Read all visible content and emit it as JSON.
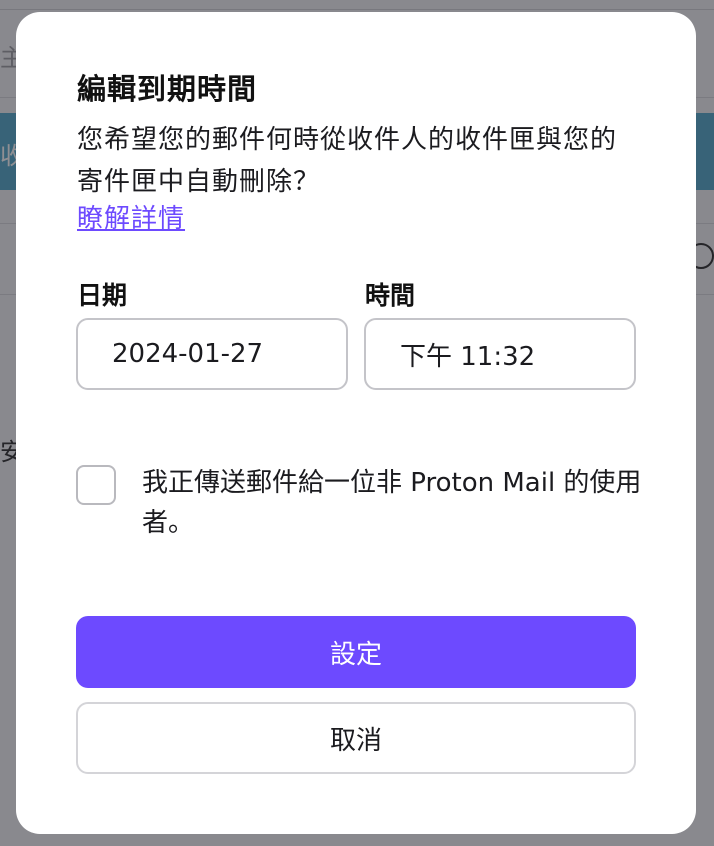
{
  "background": {
    "text_1": "主旨",
    "text_2": "收",
    "text_3": "安"
  },
  "modal": {
    "title": "編輯到期時間",
    "description": "您希望您的郵件何時從收件人的收件匣與您的寄件匣中自動刪除？",
    "learn_more": "瞭解詳情",
    "date_label": "日期",
    "date_value": "2024-01-27",
    "time_label": "時間",
    "time_value": "下午 11:32",
    "checkbox_label": "我正傳送郵件給一位非 Proton Mail 的使用者。",
    "checkbox_checked": false,
    "set_button": "設定",
    "cancel_button": "取消"
  },
  "colors": {
    "accent": "#6d4aff",
    "background_band": "#4aa3c6"
  }
}
